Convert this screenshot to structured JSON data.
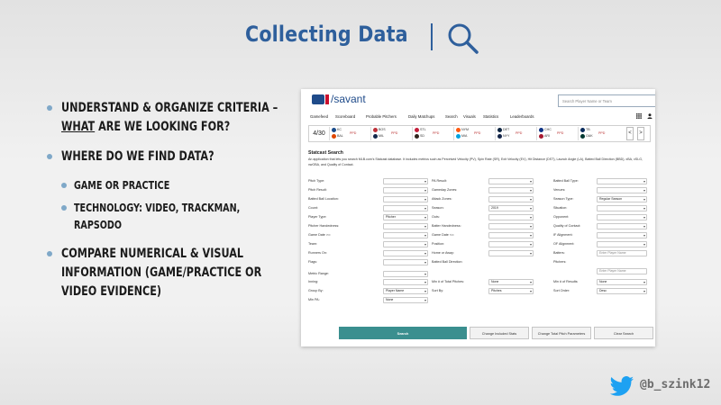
{
  "title": "Collecting Data",
  "bullets": [
    {
      "pre": "",
      "u": "",
      "post": "Understand & Organize Criteria –"
    },
    {
      "pre": "",
      "u": "What",
      "post": " are we looking for?"
    },
    {
      "pre": "",
      "u": "",
      "post": "Where do we find data?"
    },
    {
      "pre": "",
      "u": "",
      "post": "Game or Practice"
    },
    {
      "pre": "",
      "u": "",
      "post": "Technology: Video, Trackman, Rapsodo"
    },
    {
      "pre": "",
      "u": "",
      "post": "Compare Numerical & Visual information (Game/Practice or Video Evidence)"
    }
  ],
  "savant": {
    "brand": "/savant",
    "search_placeholder": "Search Player Name or Team",
    "nav": [
      "Gamefeed",
      "Scoreboard",
      "Probable Pitchers",
      "Daily Matchups",
      "Search",
      "Visuals",
      "Statistics",
      "Leaderboards"
    ],
    "date": "4/30",
    "games": [
      {
        "a": "KC",
        "b": "BAL",
        "status": "PPD"
      },
      {
        "a": "BOS",
        "b": "MIL",
        "status": "PPD"
      },
      {
        "a": "STL",
        "b": "SD",
        "status": "PPD"
      },
      {
        "a": "NYM",
        "b": "MIA",
        "status": "PPD"
      },
      {
        "a": "DET",
        "b": "NYY",
        "status": "PPD"
      },
      {
        "a": "CHC",
        "b": "ARI",
        "status": "PPD"
      },
      {
        "a": "TB",
        "b": "OAK",
        "status": "PPD"
      }
    ],
    "prev": "<",
    "next": ">",
    "section_title": "Statcast Search",
    "description": "An application that lets you search MLB.com's Statcast database. It includes metrics such as Perceived Velocity (PV), Spin Rate (SR), Exit Velocity (EV), Hit Distance (DST), Launch Angle (LA), Batted Ball Direction (BBD), xBA, xSLG, xwOBA, and Quality of Contact.",
    "rows": [
      [
        [
          "Pitch Type:",
          ""
        ],
        [
          "PA Result:",
          ""
        ],
        [
          "Batted Ball Type:",
          ""
        ]
      ],
      [
        [
          "Pitch Result:",
          ""
        ],
        [
          "Gameday Zones:",
          ""
        ],
        [
          "Venues:",
          ""
        ]
      ],
      [
        [
          "Batted Ball Location:",
          ""
        ],
        [
          "Attack Zones:",
          ""
        ],
        [
          "Season Type:",
          "Regular Season"
        ]
      ],
      [
        [
          "Count:",
          ""
        ],
        [
          "Season:",
          "2019"
        ],
        [
          "Situation:",
          ""
        ]
      ],
      [
        [
          "Player Type:",
          "Pitcher"
        ],
        [
          "Outs:",
          ""
        ],
        [
          "Opponent:",
          ""
        ]
      ],
      [
        [
          "Pitcher Handedness:",
          ""
        ],
        [
          "Batter Handedness:",
          ""
        ],
        [
          "Quality of Contact:",
          ""
        ]
      ],
      [
        [
          "Game Date >=:",
          ""
        ],
        [
          "Game Date <=:",
          ""
        ],
        [
          "IF Alignment:",
          ""
        ]
      ],
      [
        [
          "Team:",
          ""
        ],
        [
          "Position:",
          ""
        ],
        [
          "OF Alignment:",
          ""
        ]
      ],
      [
        [
          "Runners On:",
          ""
        ],
        [
          "Home or Away:",
          ""
        ],
        [
          "Batters:",
          "Enter Player Name"
        ]
      ],
      [
        [
          "Flags:",
          ""
        ],
        [
          "Batted Ball Direction:",
          ""
        ],
        [
          "Pitchers:",
          "Enter Player Name"
        ]
      ],
      [
        [
          "Metric Range:",
          ""
        ],
        null,
        null
      ],
      [
        [
          "Inning:",
          ""
        ],
        [
          "Min # of Total Pitches:",
          "None"
        ],
        [
          "Min # of Results:",
          "None"
        ]
      ],
      [
        [
          "Group By:",
          "Player Name"
        ],
        [
          "Sort By:",
          "Pitches"
        ],
        [
          "Sort Order:",
          "Desc"
        ]
      ],
      [
        [
          "Min PA:",
          "None"
        ],
        null,
        null
      ]
    ],
    "buttons": [
      "Search",
      "Change Included Stats",
      "Change Total Pitch Parameters",
      "Clear Search"
    ]
  },
  "twitter_handle": "@b_szink12",
  "colors": {
    "title": "#2e5f9c",
    "bullet_dot": "#7fa8c8",
    "search_button": "#3a8f8f",
    "twitter": "#1da1f2"
  }
}
